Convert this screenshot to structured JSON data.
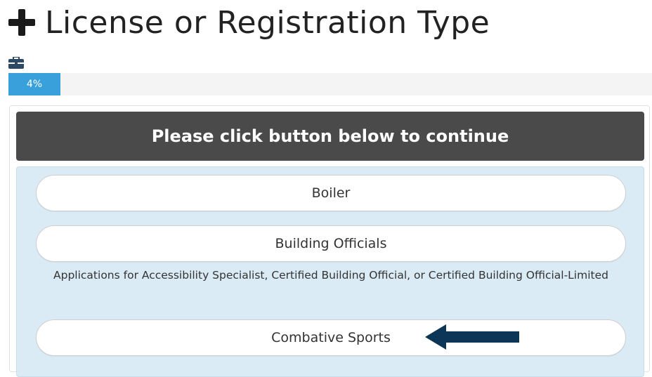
{
  "page": {
    "title": "License or Registration Type"
  },
  "progress": {
    "label": "4%",
    "fraction": 0.04
  },
  "panel": {
    "heading": "Please click button below to continue"
  },
  "options": [
    {
      "label": "Boiler"
    },
    {
      "label": "Building Officials",
      "description": "Applications for Accessibility Specialist, Certified Building Official, or Certified Building Official-Limited"
    },
    {
      "label": "Combative Sports"
    }
  ],
  "colors": {
    "progress_fill": "#3aa0db",
    "heading_bg": "#4a4a4a",
    "body_bg": "#daebf6",
    "arrow": "#0d3558"
  },
  "icons": {
    "header": "plus-icon",
    "section": "briefcase-icon",
    "annotation": "left-arrow-icon"
  }
}
